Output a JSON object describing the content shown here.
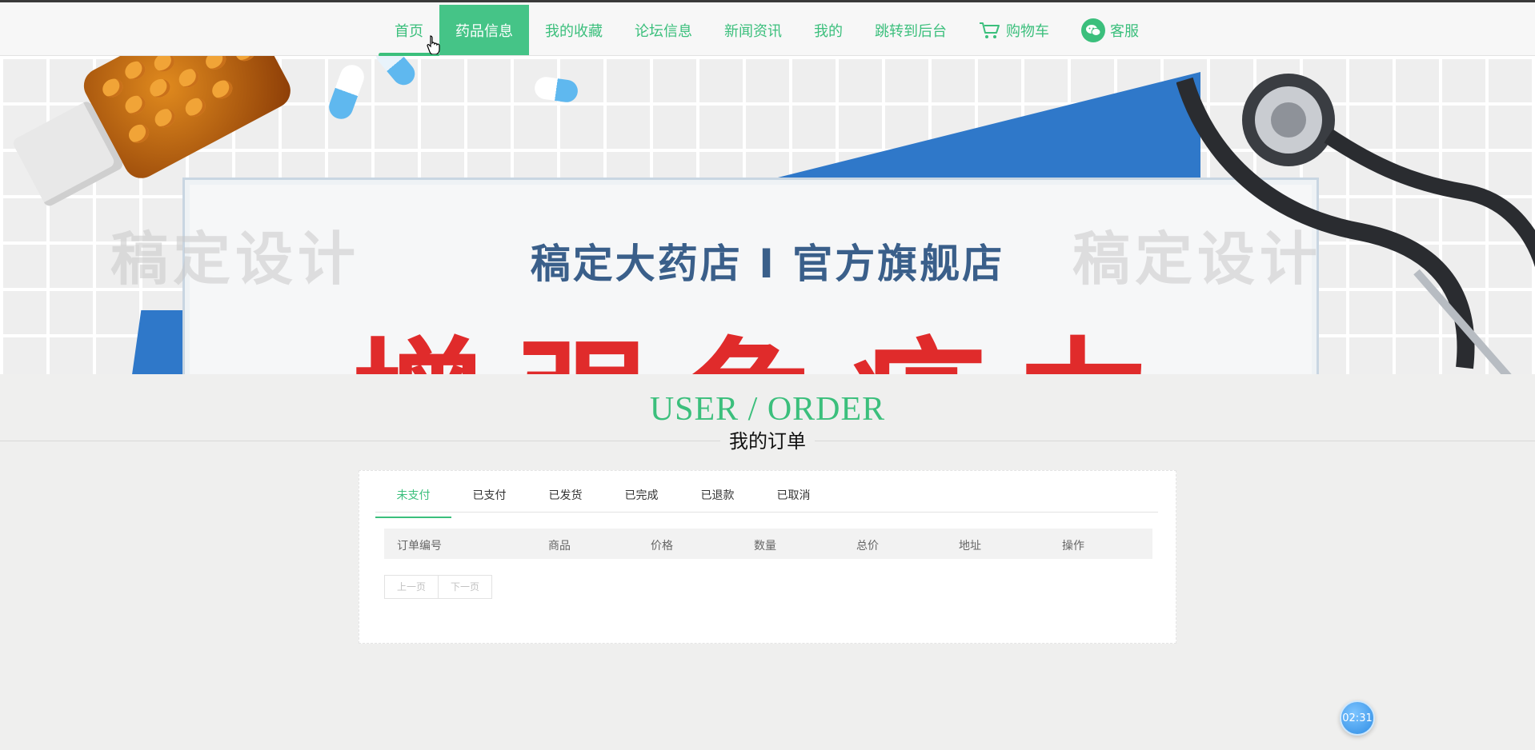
{
  "nav": {
    "items": [
      {
        "label": "首页"
      },
      {
        "label": "药品信息"
      },
      {
        "label": "我的收藏"
      },
      {
        "label": "论坛信息"
      },
      {
        "label": "新闻资讯"
      },
      {
        "label": "我的"
      },
      {
        "label": "跳转到后台"
      },
      {
        "label": "购物车",
        "icon": "cart-icon"
      },
      {
        "label": "客服",
        "icon": "wechat-icon"
      }
    ],
    "active_index": 0,
    "selected_index": 1
  },
  "banner": {
    "subtitle": "稿定大药店 I 官方旗舰店",
    "headline": "增强免疫力",
    "watermark": "稿定设计"
  },
  "section": {
    "title_en": "USER / ORDER",
    "title_cn": "我的订单"
  },
  "orders": {
    "tabs": [
      {
        "label": "未支付"
      },
      {
        "label": "已支付"
      },
      {
        "label": "已发货"
      },
      {
        "label": "已完成"
      },
      {
        "label": "已退款"
      },
      {
        "label": "已取消"
      }
    ],
    "active_tab": 0,
    "columns": [
      "订单编号",
      "商品",
      "价格",
      "数量",
      "总价",
      "地址",
      "操作"
    ],
    "rows": [],
    "pager": {
      "prev": "上一页",
      "next": "下一页"
    }
  },
  "timer": {
    "value": "02:31"
  },
  "colors": {
    "accent": "#3bbf7c",
    "accent_bg": "#45c487",
    "banner_red": "#e02b2b",
    "banner_blue": "#2f78c9",
    "timer_blue": "#2f8de4"
  }
}
